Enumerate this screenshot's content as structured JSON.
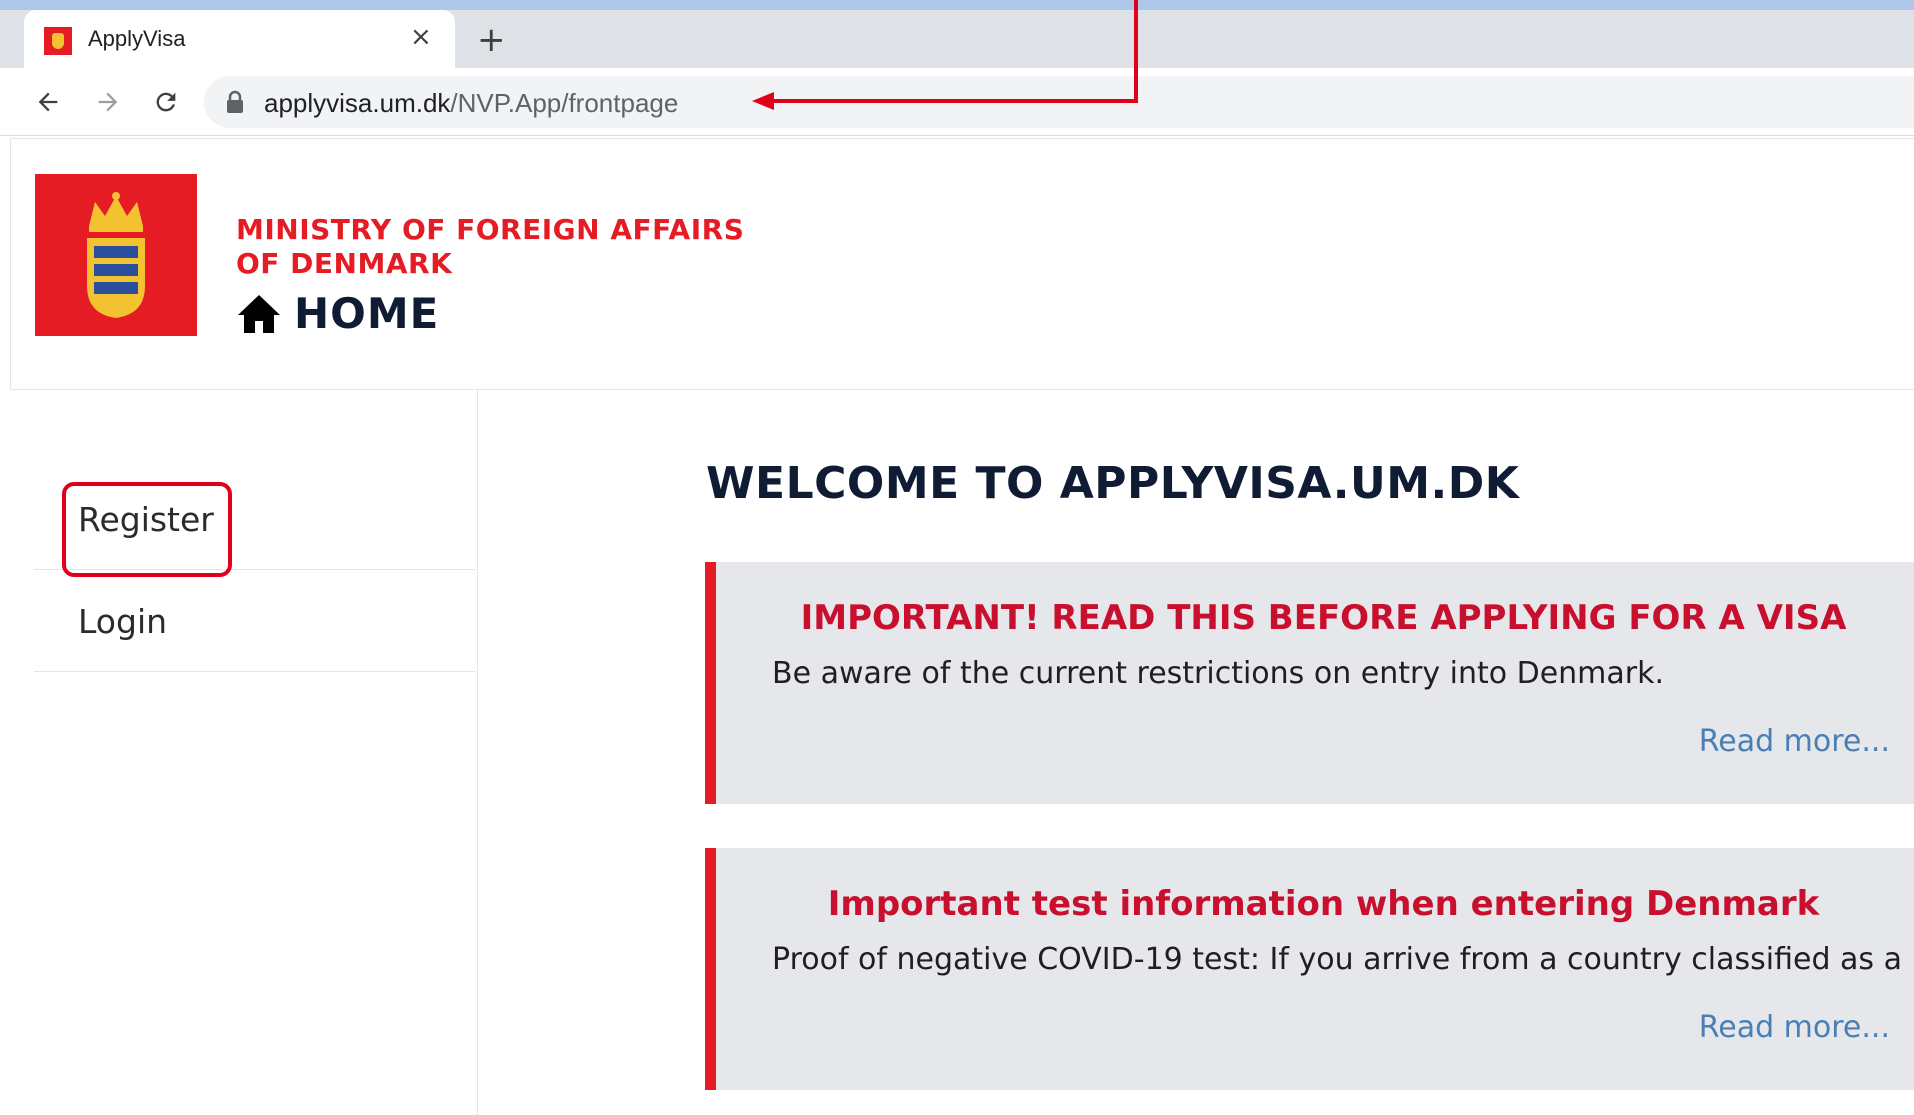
{
  "browser": {
    "tab_title": "ApplyVisa",
    "tab_close": "×",
    "new_tab": "+",
    "url_host": "applyvisa.um.dk",
    "url_path": "/NVP.App/frontpage"
  },
  "header": {
    "org_line1": "MINISTRY OF FOREIGN AFFAIRS",
    "org_line2": "OF DENMARK",
    "home_label": "HOME"
  },
  "sidebar": {
    "items": [
      {
        "label": "Register"
      },
      {
        "label": "Login"
      }
    ]
  },
  "main": {
    "welcome": "WELCOME TO APPLYVISA.UM.DK",
    "cards": [
      {
        "title": "IMPORTANT! READ THIS BEFORE APPLYING FOR A VISA",
        "body": "Be aware of the current restrictions on entry into Denmark.",
        "link": "Read more..."
      },
      {
        "title": "Important test information when entering Denmark",
        "body": "Proof of negative COVID-19 test: If you arrive from a country classified as a",
        "link": "Read more..."
      }
    ]
  },
  "colors": {
    "brand_red": "#e51c24",
    "heading_navy": "#0f1c33",
    "link_blue": "#4a7fb5",
    "annotation_red": "#e0001b"
  }
}
